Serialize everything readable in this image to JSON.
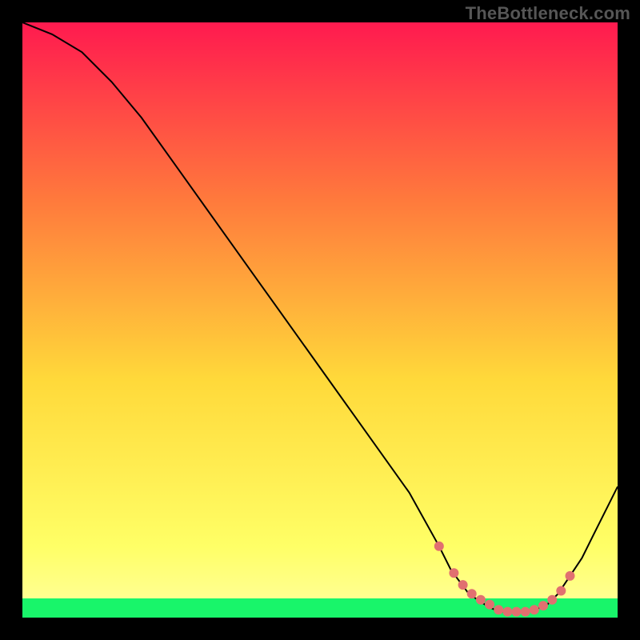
{
  "watermark": "TheBottleneck.com",
  "chart_data": {
    "type": "line",
    "title": "",
    "xlabel": "",
    "ylabel": "",
    "xlim": [
      0,
      100
    ],
    "ylim": [
      0,
      100
    ],
    "grid": false,
    "legend": false,
    "background_gradient": {
      "top": "#ff1a4f",
      "mid1": "#ff7a3c",
      "mid2": "#ffd93a",
      "mid3": "#ffff66",
      "bottom_band": "#18f56a"
    },
    "series": [
      {
        "name": "bottleneck-curve",
        "color": "#000000",
        "stroke_width": 2,
        "x": [
          0,
          5,
          10,
          15,
          20,
          25,
          30,
          35,
          40,
          45,
          50,
          55,
          60,
          65,
          70,
          72,
          75,
          78,
          80,
          82,
          85,
          88,
          90,
          92,
          94,
          96,
          98,
          100
        ],
        "y": [
          100,
          98,
          95,
          90,
          84,
          77,
          70,
          63,
          56,
          49,
          42,
          35,
          28,
          21,
          12,
          8,
          4,
          2,
          1,
          1,
          1,
          2,
          4,
          7,
          10,
          14,
          18,
          22
        ]
      }
    ],
    "markers": {
      "name": "highlight-points",
      "color": "#e17070",
      "radius": 6,
      "x": [
        70.0,
        72.5,
        74.0,
        75.5,
        77.0,
        78.5,
        80.0,
        81.5,
        83.0,
        84.5,
        86.0,
        87.5,
        89.0,
        90.5,
        92.0
      ],
      "y": [
        12.0,
        7.5,
        5.5,
        4.0,
        3.0,
        2.2,
        1.3,
        1.0,
        1.0,
        1.0,
        1.3,
        2.0,
        3.0,
        4.5,
        7.0
      ]
    }
  }
}
